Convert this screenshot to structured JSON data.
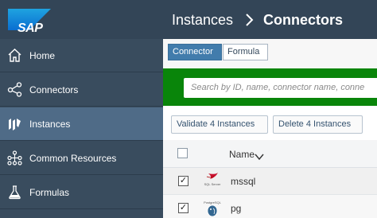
{
  "header": {
    "logo_text": "SAP",
    "breadcrumb": [
      "Instances",
      "Connectors"
    ]
  },
  "sidebar": {
    "items": [
      {
        "label": "Home",
        "icon": "home-icon",
        "active": false
      },
      {
        "label": "Connectors",
        "icon": "share-nodes-icon",
        "active": false
      },
      {
        "label": "Instances",
        "icon": "instances-icon",
        "active": true
      },
      {
        "label": "Common Resources",
        "icon": "hierarchy-icon",
        "active": false
      },
      {
        "label": "Formulas",
        "icon": "flask-icon",
        "active": false
      }
    ]
  },
  "main": {
    "tabs": [
      {
        "label": "Connector",
        "selected": true
      },
      {
        "label": "Formula",
        "selected": false
      }
    ],
    "search": {
      "placeholder": "Search by ID, name, connector name, conne"
    },
    "actions": {
      "validate_label": "Validate 4 Instances",
      "delete_label": "Delete 4 Instances"
    },
    "table": {
      "name_header": "Name",
      "rows": [
        {
          "name": "mssql",
          "checked": true,
          "logo": "sql-server-logo",
          "logo_caption": "SQL Server"
        },
        {
          "name": "pg",
          "checked": true,
          "logo": "postgresql-logo",
          "logo_caption": "PostgreSQL"
        }
      ]
    }
  },
  "colors": {
    "header_bg": "#334557",
    "sidebar_bg": "#394c5e",
    "sidebar_active": "#4f6b87",
    "accent_blue": "#427cac",
    "search_band": "#09850a"
  }
}
